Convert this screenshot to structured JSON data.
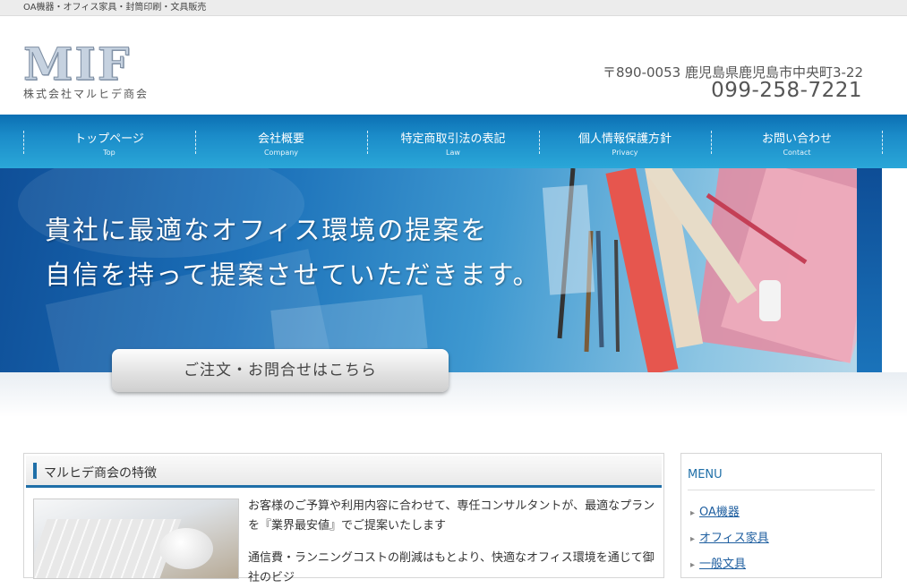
{
  "topbar": {
    "text": "OA機器・オフィス家具・封筒印刷・文具販売"
  },
  "header": {
    "logo_mark": "MIF",
    "logo_name": "株式会社マルヒデ商会",
    "address": "〒890-0053 鹿児島県鹿児島市中央町3-22",
    "phone": "099-258-7221"
  },
  "nav": {
    "items": [
      {
        "jp": "トップページ",
        "en": "Top"
      },
      {
        "jp": "会社概要",
        "en": "Company"
      },
      {
        "jp": "特定商取引法の表記",
        "en": "Law"
      },
      {
        "jp": "個人情報保護方針",
        "en": "Privacy"
      },
      {
        "jp": "お問い合わせ",
        "en": "Contact"
      }
    ]
  },
  "hero": {
    "line1": "貴社に最適なオフィス環境の提案を",
    "line2": "自信を持って提案させていただきます。",
    "cta": "ご注文・お問合せはこちら"
  },
  "main": {
    "title": "マルヒデ商会の特徴",
    "para1": "お客様のご予算や利用内容に合わせて、専任コンサルタントが、最適なプランを『業界最安値』でご提案いたします",
    "para2": "通信費・ランニングコストの削減はもとより、快適なオフィス環境を通じて御社のビジ"
  },
  "sidebar": {
    "title": "MENU",
    "items": [
      "OA機器",
      "オフィス家具",
      "一般文具"
    ]
  },
  "colors": {
    "brand_blue": "#1f6fa8",
    "nav_top": "#0b6fb3",
    "nav_bottom": "#2aa7d8"
  }
}
